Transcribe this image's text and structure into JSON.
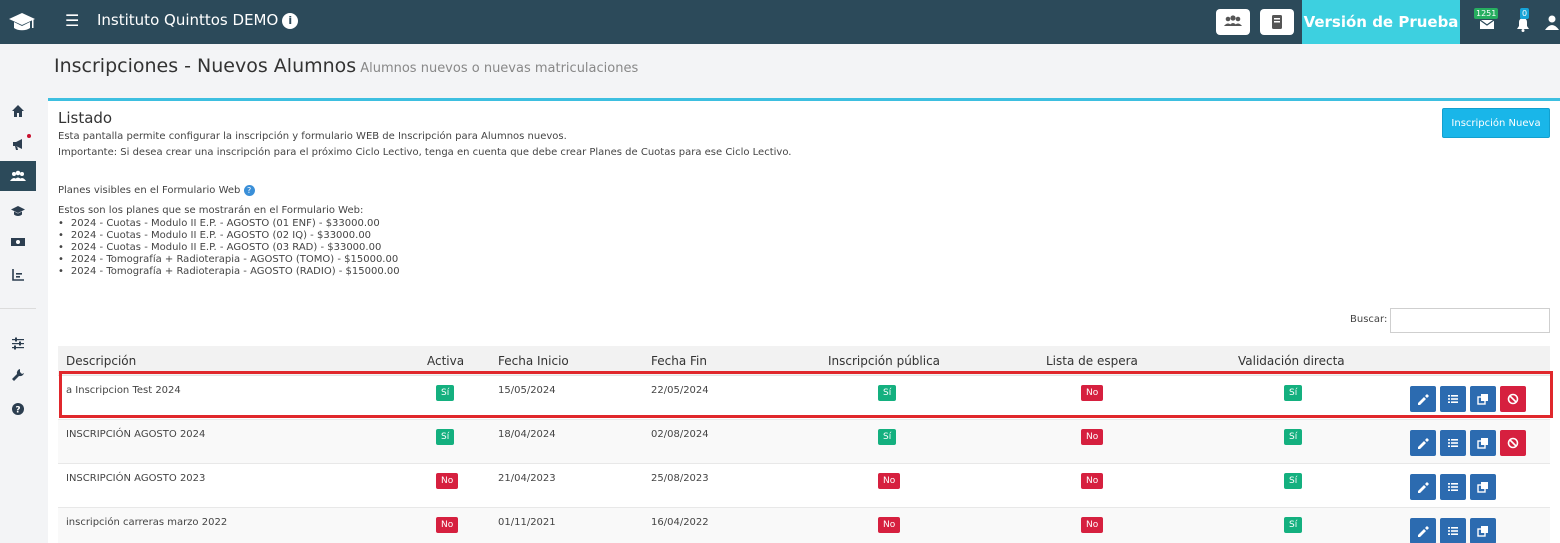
{
  "app": {
    "title": "Instituto Quinttos DEMO",
    "trial_label": "Versión de Prueba",
    "mail_count": "1251",
    "notif_count": "0"
  },
  "header": {
    "title": "Inscripciones - Nuevos Alumnos",
    "subtitle": "Alumnos nuevos o nuevas matriculaciones"
  },
  "panel": {
    "title": "Listado",
    "desc1": "Esta pantalla permite configurar la inscripción y formulario WEB de Inscripción para Alumnos nuevos.",
    "desc2": "Importante: Si desea crear una inscripción para el próximo Ciclo Lectivo, tenga en cuenta que debe crear Planes de Cuotas para ese Ciclo Lectivo.",
    "new_button": "Inscripción Nueva",
    "plans_heading": "Planes visibles en el Formulario Web",
    "plans_intro": "Estos son los planes que se mostrarán en el Formulario Web:",
    "plans": [
      "2024 - Cuotas - Modulo II E.P. - AGOSTO (01 ENF) - $33000.00",
      "2024 - Cuotas - Modulo II E.P. - AGOSTO (02 IQ) - $33000.00",
      "2024 - Cuotas - Modulo II E.P. - AGOSTO (03 RAD) - $33000.00",
      "2024 - Tomografía + Radioterapia - AGOSTO (TOMO) - $15000.00",
      "2024 - Tomografía + Radioterapia - AGOSTO (RADIO) - $15000.00"
    ],
    "search_label": "Buscar:",
    "search_value": ""
  },
  "table": {
    "columns": [
      "Descripción",
      "Activa",
      "Fecha Inicio",
      "Fecha Fin",
      "Inscripción pública",
      "Lista de espera",
      "Validación directa"
    ],
    "rows": [
      {
        "descripcion": "a Inscripcion Test 2024",
        "activa": "Sí",
        "inicio": "15/05/2024",
        "fin": "22/05/2024",
        "publica": "Sí",
        "espera": "No",
        "validacion": "Sí"
      },
      {
        "descripcion": "INSCRIPCIÓN AGOSTO 2024",
        "activa": "Sí",
        "inicio": "18/04/2024",
        "fin": "02/08/2024",
        "publica": "Sí",
        "espera": "No",
        "validacion": "Sí"
      },
      {
        "descripcion": "INSCRIPCIÓN AGOSTO 2023",
        "activa": "No",
        "inicio": "21/04/2023",
        "fin": "25/08/2023",
        "publica": "No",
        "espera": "No",
        "validacion": "Sí"
      },
      {
        "descripcion": "inscripción carreras marzo 2022",
        "activa": "No",
        "inicio": "01/11/2021",
        "fin": "16/04/2022",
        "publica": "No",
        "espera": "No",
        "validacion": "Sí"
      }
    ]
  },
  "colors": {
    "topbar": "#2c4a5a",
    "accent": "#3dd0e0",
    "yes": "#14b07f",
    "no": "#d6203f",
    "action_blue": "#2c6bb0",
    "highlight": "#e0272c"
  },
  "icons": {
    "sidebar": [
      "home-icon",
      "megaphone-icon",
      "users-icon",
      "graduation-cap-icon",
      "money-icon",
      "chart-icon",
      "sliders-icon",
      "wrench-icon",
      "help-icon"
    ],
    "row_actions": [
      "edit-icon",
      "list-icon",
      "copy-icon",
      "ban-icon"
    ]
  }
}
